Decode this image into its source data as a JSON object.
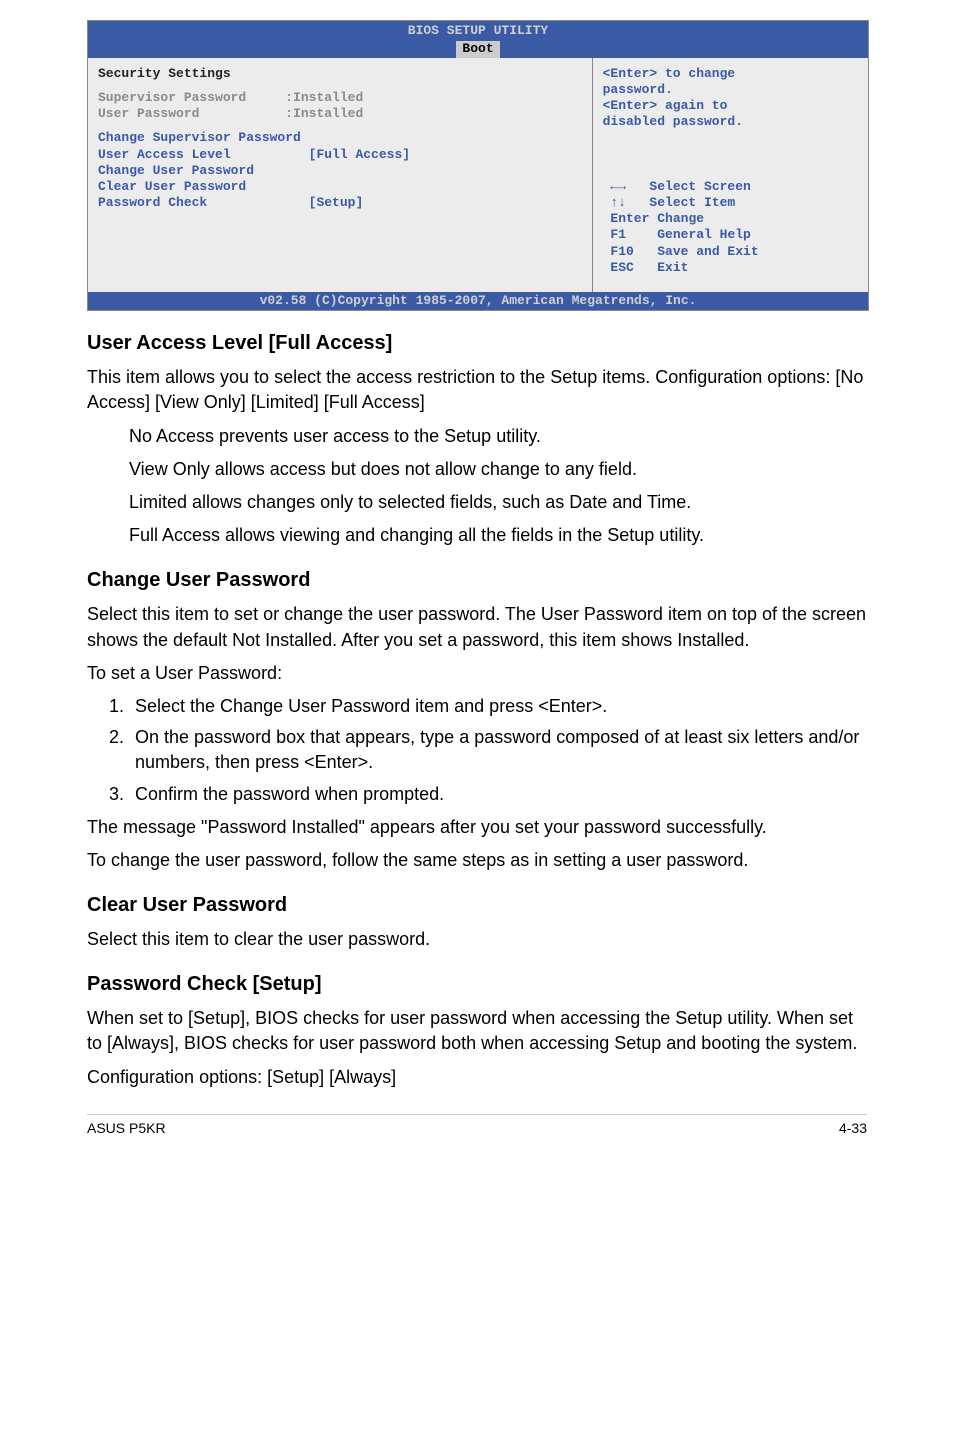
{
  "bios": {
    "header_title": "BIOS SETUP UTILITY",
    "tab": "Boot",
    "left": {
      "section_title": "Security Settings",
      "status_rows": [
        {
          "label": "Supervisor Password",
          "value": ":Installed"
        },
        {
          "label": "User Password",
          "value": ":Installed"
        }
      ],
      "items": [
        {
          "label": "Change Supervisor Password",
          "value": ""
        },
        {
          "label": "User Access Level",
          "value": "[Full Access]"
        },
        {
          "label": "Change User Password",
          "value": ""
        },
        {
          "label": "Clear User Password",
          "value": ""
        },
        {
          "label": "Password Check",
          "value": "[Setup]"
        }
      ]
    },
    "right": {
      "help1": "<Enter> to change",
      "help2": "password.",
      "help3": "<Enter> again to",
      "help4": "disabled password.",
      "nav": [
        {
          "key": "←→",
          "text": "Select Screen"
        },
        {
          "key": "↑↓",
          "text": "Select Item"
        },
        {
          "key": "Enter",
          "text": "Change"
        },
        {
          "key": "F1",
          "text": "General Help"
        },
        {
          "key": "F10",
          "text": "Save and Exit"
        },
        {
          "key": "ESC",
          "text": "Exit"
        }
      ]
    },
    "footer": "v02.58 (C)Copyright 1985-2007, American Megatrends, Inc."
  },
  "sections": {
    "ual_title": "User Access Level [Full Access]",
    "ual_p1": "This item allows you to select the access restriction to the Setup items. Configuration options: [No Access] [View Only] [Limited] [Full Access]",
    "ual_b1": "No Access prevents user access to the Setup utility.",
    "ual_b2": "View Only allows access but does not allow change to any field.",
    "ual_b3": "Limited allows changes only to selected fields, such as Date and Time.",
    "ual_b4": "Full Access allows viewing and changing all the fields in the Setup utility.",
    "cup_title": "Change User Password",
    "cup_p1": "Select this item to set or change the user password. The User Password item on top of the screen shows the default Not Installed. After you set a password, this item shows Installed.",
    "cup_p2": "To set a User Password:",
    "cup_l1": "Select the Change User Password item and press <Enter>.",
    "cup_l2": "On the password box that appears, type a password composed of at least six letters and/or numbers, then press <Enter>.",
    "cup_l3": "Confirm the password when prompted.",
    "cup_p3": "The message \"Password Installed\" appears after you set your password successfully.",
    "cup_p4": "To change the user password, follow the same steps as in setting a user password.",
    "clrup_title": "Clear User Password",
    "clrup_p1": "Select this item to clear the user password.",
    "pc_title": "Password Check [Setup]",
    "pc_p1": "When set to [Setup], BIOS checks for user password when accessing the Setup utility. When set to [Always], BIOS checks for user password both when accessing Setup and booting the system.",
    "pc_p2": "Configuration options: [Setup] [Always]"
  },
  "footer": {
    "left": "ASUS P5KR",
    "right": "4-33"
  }
}
